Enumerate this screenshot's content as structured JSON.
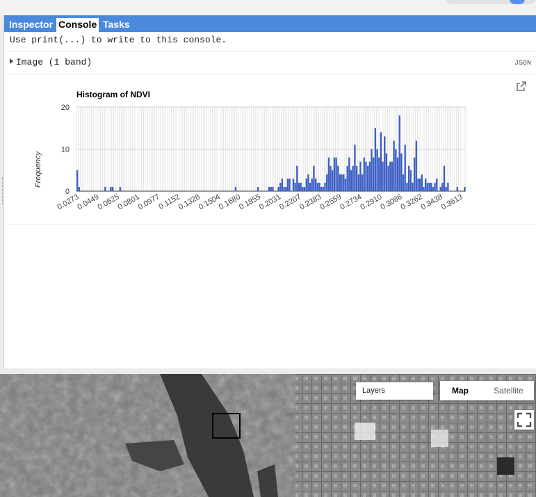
{
  "tabs": [
    {
      "label": "Inspector",
      "active": false
    },
    {
      "label": "Console",
      "active": true
    },
    {
      "label": "Tasks",
      "active": false
    }
  ],
  "console": {
    "hint": "Use print(...) to write to this console.",
    "object_label": "Image (1 band)",
    "json_label": "JSON"
  },
  "colors": {
    "tab_bar": "#4a89dc",
    "bar": "#3b5fc6"
  },
  "icons": [
    "popout-icon",
    "caret-right-icon",
    "fullscreen-icon"
  ],
  "chart_data": {
    "type": "bar",
    "title": "Histogram of NDVI",
    "xlabel": "",
    "ylabel": "Frequency",
    "ylim": [
      0,
      20
    ],
    "yticks": [
      0,
      10,
      20
    ],
    "xlim": [
      0.0273,
      0.3657
    ],
    "xticks": [
      "0.0273",
      "0.0449",
      "0.0625",
      "0.0801",
      "0.0977",
      "0.1152",
      "0.1328",
      "0.1504",
      "0.1680",
      "0.1855",
      "0.2031",
      "0.2207",
      "0.2383",
      "0.2559",
      "0.2734",
      "0.2910",
      "0.3086",
      "0.3262",
      "0.3438",
      "0.3613"
    ],
    "bin_width": 0.00176,
    "values": [
      5,
      1,
      0,
      0,
      0,
      0,
      0,
      0,
      0,
      0,
      0,
      0,
      0,
      0,
      0,
      1,
      0,
      0,
      1,
      1,
      0,
      0,
      0,
      1,
      0,
      0,
      0,
      0,
      0,
      0,
      0,
      0,
      0,
      0,
      0,
      0,
      0,
      0,
      0,
      0,
      0,
      0,
      0,
      0,
      0,
      0,
      0,
      0,
      0,
      0,
      0,
      0,
      0,
      0,
      0,
      0,
      0,
      0,
      0,
      0,
      0,
      0,
      0,
      0,
      0,
      0,
      0,
      0,
      0,
      0,
      0,
      0,
      0,
      0,
      0,
      0,
      0,
      0,
      0,
      0,
      0,
      0,
      0,
      0,
      0,
      1,
      0,
      0,
      0,
      0,
      0,
      0,
      0,
      0,
      0,
      0,
      0,
      1,
      0,
      0,
      0,
      0,
      0,
      1,
      1,
      1,
      0,
      0,
      1,
      2,
      3,
      1,
      1,
      3,
      3,
      0,
      3,
      2,
      6,
      2,
      2,
      1,
      1,
      3,
      4,
      2,
      3,
      6,
      3,
      2,
      2,
      1,
      1,
      2,
      4,
      8,
      6,
      5,
      8,
      8,
      6,
      4,
      4,
      4,
      3,
      6,
      8,
      5,
      6,
      11,
      6,
      4,
      7,
      4,
      8,
      7,
      6,
      7,
      10,
      8,
      15,
      10,
      8,
      14,
      7,
      13,
      9,
      6,
      7,
      7,
      12,
      10,
      8,
      18,
      9,
      4,
      11,
      2,
      6,
      5,
      2,
      8,
      12,
      3,
      3,
      4,
      1,
      3,
      2,
      2,
      2,
      1,
      2,
      3,
      0,
      1,
      2,
      6,
      1,
      2,
      0,
      0,
      0,
      0,
      1,
      0,
      0,
      0,
      1
    ]
  }
}
